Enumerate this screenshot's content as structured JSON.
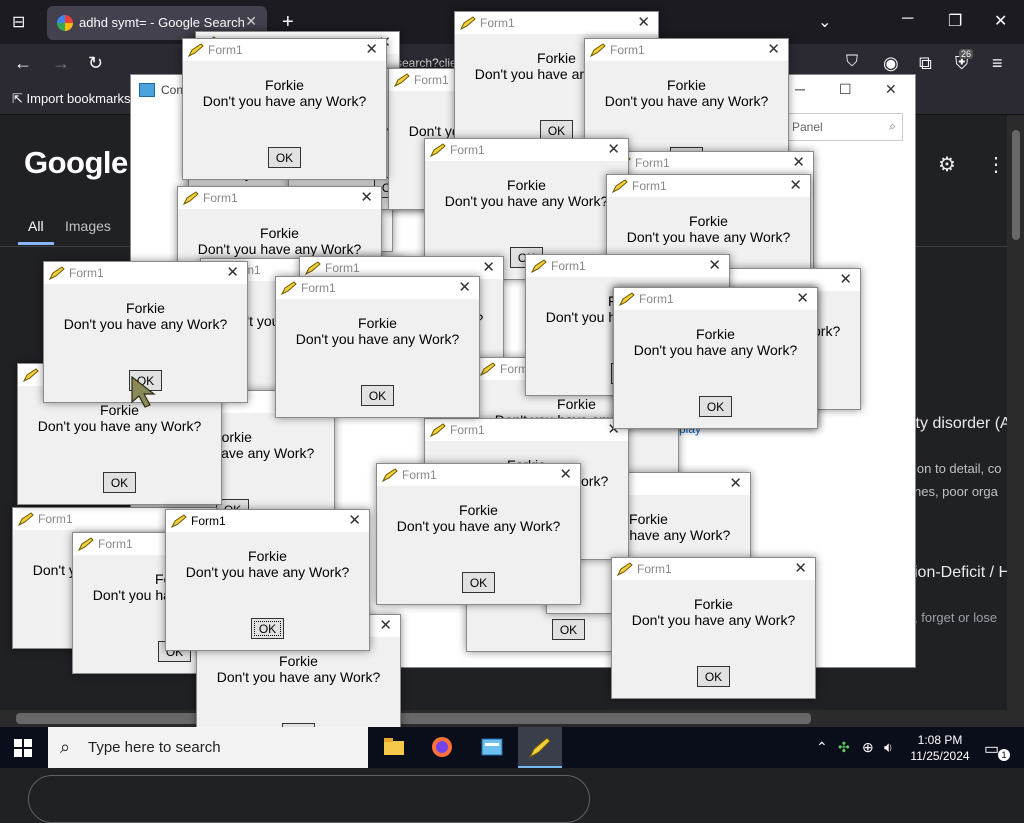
{
  "browser": {
    "tab_title": "adhd symt= - Google Search",
    "tab_close": "✕",
    "new_tab": "+",
    "url_fragment": "search?clie",
    "bookmark": "Import bookmarks…",
    "ext_badge": "26"
  },
  "google": {
    "logo": "Google",
    "tabs": {
      "all": "All",
      "images": "Images"
    },
    "snippets": [
      "ity disorder (A",
      "ion to detail, co",
      "nes, poor orga",
      "ion-Deficit / H",
      ", forget or lose"
    ]
  },
  "control_panel": {
    "title": "Con",
    "search_placeholder": "Panel",
    "link": "play"
  },
  "dialog": {
    "title": "Form1",
    "name": "Forkie",
    "message": "Don't you have any Work?",
    "ok": "OK"
  },
  "taskbar": {
    "search_placeholder": "Type here to search",
    "time": "1:08 PM",
    "date": "11/25/2024",
    "notification_count": "1"
  },
  "colors": {
    "taskbar": "#0a0d1a",
    "browser_tab": "#42414d",
    "dialog_bg": "#f0f0f0",
    "google_bg": "#202124"
  }
}
